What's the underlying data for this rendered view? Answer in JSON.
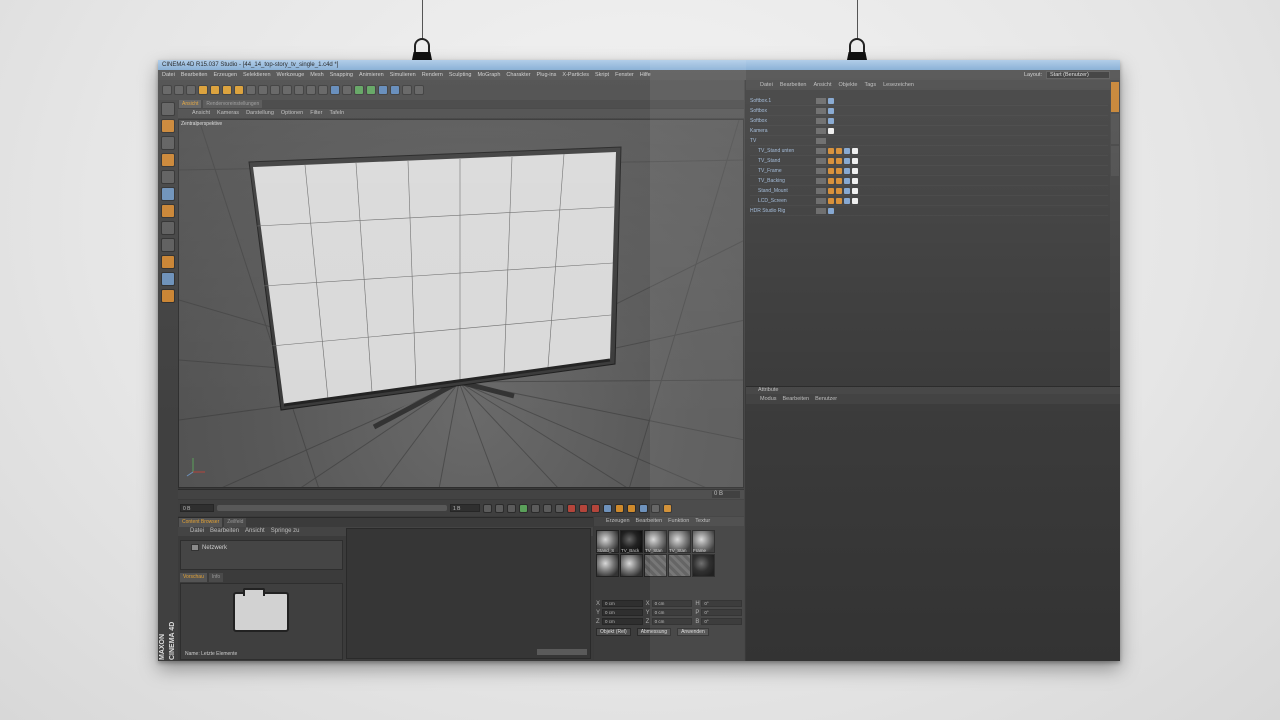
{
  "window": {
    "title": "CINEMA 4D R15.037 Studio - [44_14_top-story_tv_single_1.c4d *]",
    "layout_label": "Layout:",
    "layout_value": "Start (Benutzer)"
  },
  "menubar": [
    "Datei",
    "Bearbeiten",
    "Erzeugen",
    "Selektieren",
    "Werkzeuge",
    "Mesh",
    "Snapping",
    "Animieren",
    "Simulieren",
    "Rendern",
    "Sculpting",
    "MoGraph",
    "Charakter",
    "Plug-ins",
    "X-Particles",
    "Skript",
    "Fenster",
    "Hilfe"
  ],
  "viewport": {
    "tabs": [
      "Ansicht",
      "Rendervoreinstellungen"
    ],
    "menu": [
      "Ansicht",
      "Kameras",
      "Darstellung",
      "Optionen",
      "Filter",
      "Tafeln"
    ],
    "label": "Zentralperspektive"
  },
  "timeline": {
    "start_field": "0 B",
    "current": "0",
    "end_field": "0 B",
    "range_start": "0 B",
    "range_end": "1 B"
  },
  "content_browser": {
    "tabs": [
      "Content Browser",
      "Zeilfeld"
    ],
    "menu": [
      "Datei",
      "Bearbeiten",
      "Ansicht",
      "Springe zu"
    ],
    "tree_item": "Netzwerk",
    "preview_tabs": [
      "Vorschau",
      "Info"
    ],
    "name_label": "Name: Letzte Elemente"
  },
  "materials": {
    "menu": [
      "Erzeugen",
      "Bearbeiten",
      "Funktion",
      "Textur"
    ],
    "items": [
      {
        "label": "Stand_S",
        "style": "light"
      },
      {
        "label": "TV_Back",
        "style": "dark"
      },
      {
        "label": "TV_Stan",
        "style": "light"
      },
      {
        "label": "TV_Stan",
        "style": "light"
      },
      {
        "label": "Frame",
        "style": "light"
      },
      {
        "label": "",
        "style": "light"
      },
      {
        "label": "",
        "style": "light"
      },
      {
        "label": "",
        "style": "hatch"
      },
      {
        "label": "",
        "style": "hatch"
      },
      {
        "label": "",
        "style": "dark"
      }
    ]
  },
  "coordinates": {
    "rows": [
      [
        {
          "ax": "X",
          "val": "0 cm"
        },
        {
          "ax": "X",
          "val": "0 cm"
        },
        {
          "ax": "H",
          "val": "0°"
        }
      ],
      [
        {
          "ax": "Y",
          "val": "0 cm"
        },
        {
          "ax": "Y",
          "val": "0 cm"
        },
        {
          "ax": "P",
          "val": "0°"
        }
      ],
      [
        {
          "ax": "Z",
          "val": "0 cm"
        },
        {
          "ax": "Z",
          "val": "0 cm"
        },
        {
          "ax": "B",
          "val": "0°"
        }
      ]
    ],
    "mode": "Objekt (Rel)",
    "size_mode": "Abmessung",
    "apply": "Anwenden"
  },
  "object_manager": {
    "menu": [
      "Datei",
      "Bearbeiten",
      "Ansicht",
      "Objekte",
      "Tags",
      "Lesezeichen"
    ],
    "objects": [
      {
        "name": "Softbox.1",
        "indent": false,
        "tags": [
          "b"
        ]
      },
      {
        "name": "Softbox",
        "indent": false,
        "tags": [
          "b"
        ]
      },
      {
        "name": "Softbox",
        "indent": false,
        "tags": [
          "b"
        ]
      },
      {
        "name": "Kamera",
        "indent": false,
        "tags": [
          "w"
        ]
      },
      {
        "name": "TV",
        "indent": false,
        "tags": []
      },
      {
        "name": "TV_Stand unten",
        "indent": true,
        "tags": [
          "o",
          "o",
          "b",
          "w"
        ]
      },
      {
        "name": "TV_Stand",
        "indent": true,
        "tags": [
          "o",
          "o",
          "b",
          "w"
        ]
      },
      {
        "name": "TV_Frame",
        "indent": true,
        "tags": [
          "o",
          "o",
          "b",
          "w"
        ]
      },
      {
        "name": "TV_Backing",
        "indent": true,
        "tags": [
          "o",
          "o",
          "b",
          "w"
        ]
      },
      {
        "name": "Stand_Mount",
        "indent": true,
        "tags": [
          "o",
          "o",
          "b",
          "w"
        ]
      },
      {
        "name": "LCD_Screen",
        "indent": true,
        "tags": [
          "o",
          "o",
          "b",
          "w"
        ]
      },
      {
        "name": "HDR Studio Rig",
        "indent": false,
        "tags": [
          "b"
        ]
      }
    ]
  },
  "attributes": {
    "title": "Attribute",
    "menu": [
      "Modus",
      "Bearbeiten",
      "Benutzer"
    ]
  },
  "brand": {
    "line1": "MAXON",
    "line2": "CINEMA 4D"
  },
  "colors": {
    "accent": "#e3a235",
    "titlebar": "#8fb4da",
    "object_name": "#9fb9d8"
  }
}
